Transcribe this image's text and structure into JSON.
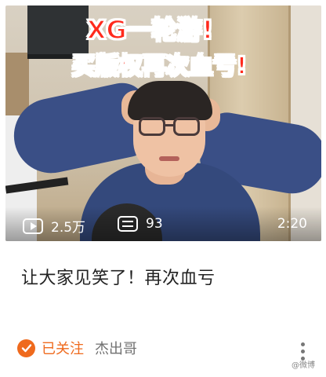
{
  "video": {
    "thumbnail": {
      "title_line1": "XG一轮游!",
      "title_line2": "买版权再次血亏!"
    },
    "stats": {
      "plays": "2.5万",
      "comments": "93",
      "duration": "2:20"
    },
    "caption": "让大家见笑了！再次血亏"
  },
  "author": {
    "follow_status": "已关注",
    "name": "杰出哥"
  },
  "watermark": "@微博",
  "icons": {
    "play": "play-icon",
    "comment": "comment-icon",
    "followed": "check-circle-icon",
    "more": "more-vertical-icon"
  },
  "colors": {
    "accent": "#ef6a1d",
    "title_red": "#ff2a1c"
  }
}
